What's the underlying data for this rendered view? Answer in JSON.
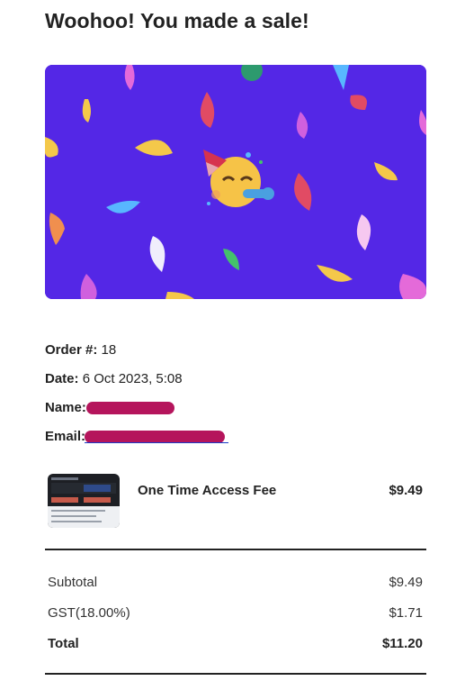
{
  "email": {
    "heading": "Woohoo! You made a sale!",
    "banner": {
      "icon": "party-face-icon",
      "background": "#5427e6"
    },
    "order": {
      "order_label": "Order #:",
      "order_value": "18",
      "date_label": "Date:",
      "date_value": "6 Oct 2023, 5:08",
      "name_label": "Name:",
      "email_label": "Email:"
    },
    "product": {
      "name": "One Time Access Fee",
      "price": "$9.49",
      "thumbnail": "product-thumbnail"
    },
    "totals": [
      {
        "label": "Subtotal",
        "amount": "$9.49"
      },
      {
        "label": "GST(18.00%)",
        "amount": "$1.71"
      },
      {
        "label": "Total",
        "amount": "$11.20"
      }
    ],
    "colors": {
      "redaction": "#b5155c",
      "link": "#1a3cc7"
    }
  }
}
